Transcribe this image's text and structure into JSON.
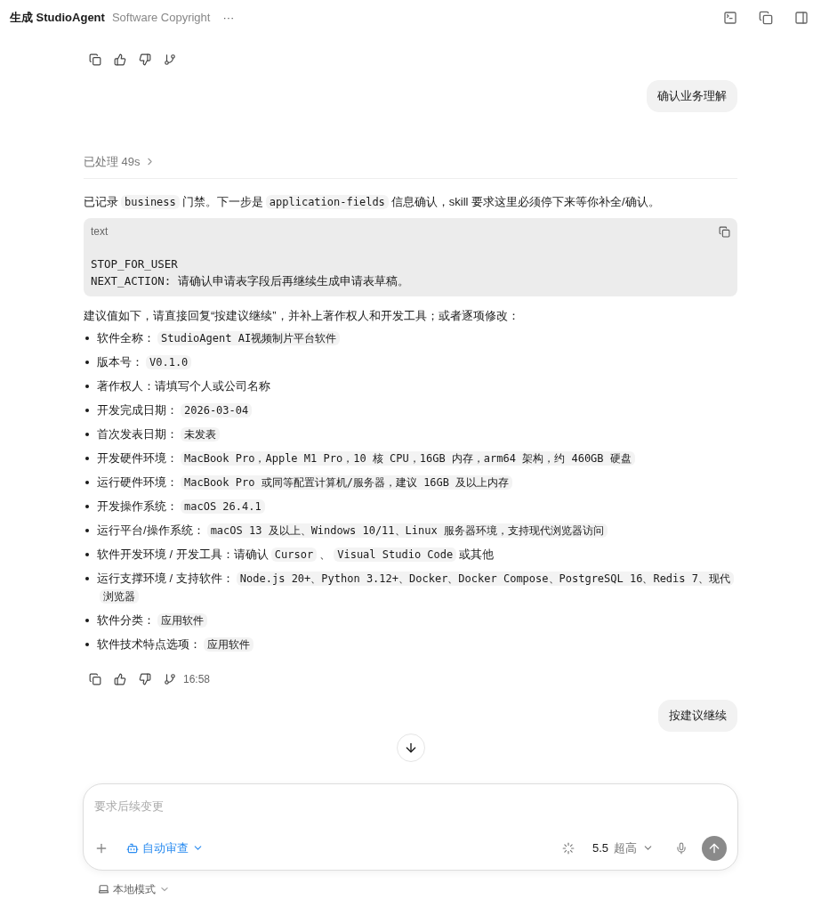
{
  "header": {
    "title": "生成 StudioAgent",
    "subtitle": "Software Copyright",
    "more": "···"
  },
  "user_messages": [
    "确认业务理解",
    "按建议继续"
  ],
  "processed": "已处理 49s",
  "intro": [
    {
      "kind": "text",
      "text": "已记录"
    },
    {
      "kind": "code",
      "text": "business"
    },
    {
      "kind": "text",
      "text": "门禁。下一步是"
    },
    {
      "kind": "code",
      "text": "application-fields"
    },
    {
      "kind": "text",
      "text": "信息确认，skill 要求这里必须停下来等你补全/确认。"
    }
  ],
  "code_block": {
    "language": "text",
    "lines": [
      "STOP_FOR_USER",
      "NEXT_ACTION: 请确认申请表字段后再继续生成申请表草稿。"
    ]
  },
  "lead": "建议值如下，请直接回复“按建议继续”，并补上著作权人和开发工具；或者逐项修改：",
  "items": [
    {
      "label": "软件全称：",
      "parts": [
        {
          "kind": "code",
          "text": "StudioAgent AI视频制片平台软件"
        }
      ]
    },
    {
      "label": "版本号：",
      "parts": [
        {
          "kind": "code",
          "text": "V0.1.0"
        }
      ]
    },
    {
      "label": "著作权人：",
      "parts": [
        {
          "kind": "text",
          "text": "请填写个人或公司名称"
        }
      ]
    },
    {
      "label": "开发完成日期：",
      "parts": [
        {
          "kind": "code",
          "text": "2026-03-04"
        }
      ]
    },
    {
      "label": "首次发表日期：",
      "parts": [
        {
          "kind": "code",
          "text": "未发表"
        }
      ]
    },
    {
      "label": "开发硬件环境：",
      "parts": [
        {
          "kind": "code",
          "text": "MacBook Pro，Apple M1 Pro，10 核 CPU，16GB 内存，arm64 架构，约 460GB 硬盘"
        }
      ]
    },
    {
      "label": "运行硬件环境：",
      "parts": [
        {
          "kind": "code",
          "text": "MacBook Pro 或同等配置计算机/服务器，建议 16GB 及以上内存"
        }
      ]
    },
    {
      "label": "开发操作系统：",
      "parts": [
        {
          "kind": "code",
          "text": "macOS 26.4.1"
        }
      ]
    },
    {
      "label": "运行平台/操作系统：",
      "parts": [
        {
          "kind": "code",
          "text": "macOS 13 及以上、Windows 10/11、Linux 服务器环境，支持现代浏览器访问"
        }
      ]
    },
    {
      "label": "软件开发环境 / 开发工具：",
      "parts": [
        {
          "kind": "text",
          "text": "请确认"
        },
        {
          "kind": "code",
          "text": "Cursor"
        },
        {
          "kind": "text",
          "text": "、"
        },
        {
          "kind": "code",
          "text": "Visual Studio Code"
        },
        {
          "kind": "text",
          "text": "或其他"
        }
      ]
    },
    {
      "label": "运行支撑环境 / 支持软件：",
      "parts": [
        {
          "kind": "code",
          "text": "Node.js 20+、Python 3.12+、Docker、Docker Compose、PostgreSQL 16、Redis 7、现代"
        },
        {
          "kind": "code",
          "text": "浏览器"
        }
      ]
    },
    {
      "label": "软件分类：",
      "parts": [
        {
          "kind": "code",
          "text": "应用软件"
        }
      ]
    },
    {
      "label": "软件技术特点选项：",
      "parts": [
        {
          "kind": "code",
          "text": "应用软件"
        }
      ]
    }
  ],
  "timestamp": "16:58",
  "composer": {
    "placeholder": "要求后续变更",
    "review": "自动审查",
    "model": "5.5",
    "effort": "超高"
  },
  "mode": "本地模式"
}
